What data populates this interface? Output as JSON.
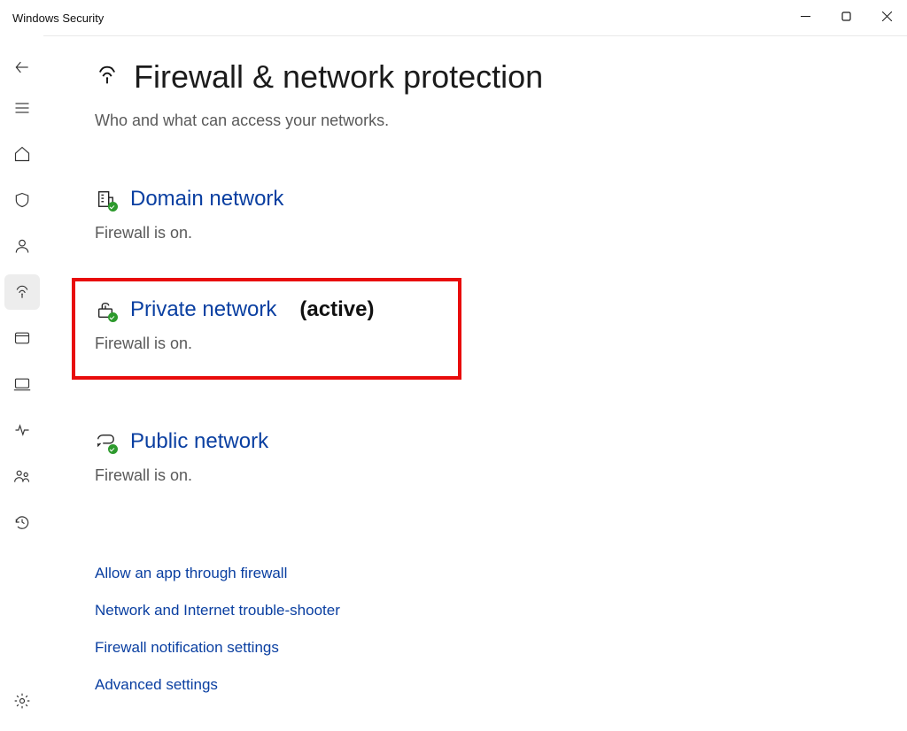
{
  "window": {
    "title": "Windows Security"
  },
  "page": {
    "title": "Firewall & network protection",
    "subtitle": "Who and what can access your networks."
  },
  "networks": {
    "domain": {
      "label": "Domain network",
      "status": "Firewall is on."
    },
    "private": {
      "label": "Private network",
      "active": "(active)",
      "status": "Firewall is on."
    },
    "public": {
      "label": "Public network",
      "status": "Firewall is on."
    }
  },
  "links": {
    "allow": "Allow an app through firewall",
    "trouble": "Network and Internet trouble-shooter",
    "notif": "Firewall notification settings",
    "adv": "Advanced settings"
  }
}
